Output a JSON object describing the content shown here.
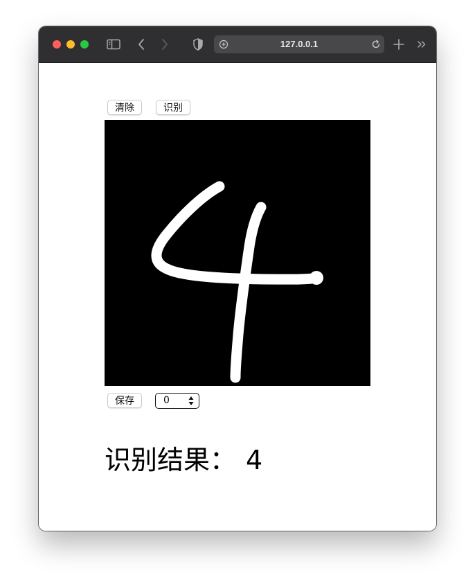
{
  "browser": {
    "url": "127.0.0.1",
    "icons": [
      "sidebar-icon",
      "back-icon",
      "forward-icon",
      "shield-icon",
      "site-icon",
      "reload-icon",
      "new-tab-icon",
      "more-icon"
    ]
  },
  "toolbar": {
    "clear_label": "清除",
    "recognize_label": "识别"
  },
  "controls": {
    "save_label": "保存",
    "select_value": "0"
  },
  "result": {
    "label": "识别结果：",
    "value": "4"
  },
  "colors": {
    "canvas_bg": "#000000",
    "stroke": "#ffffff",
    "titlebar": "#2f2f31"
  }
}
